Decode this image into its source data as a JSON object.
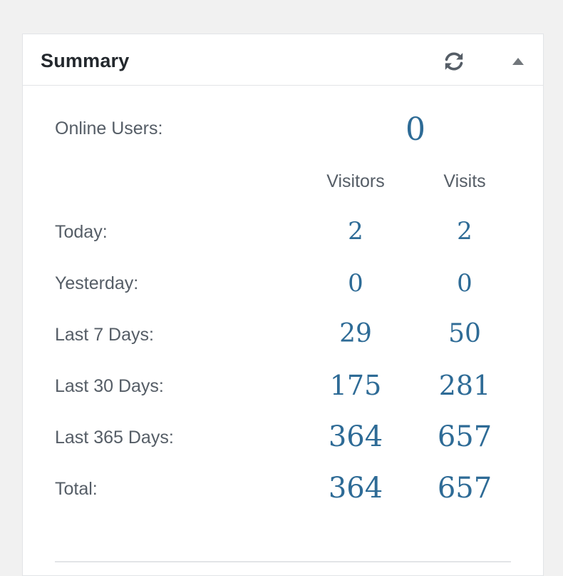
{
  "widget": {
    "title": "Summary",
    "refresh_icon": "refresh-icon",
    "toggle_icon": "triangle-up-icon"
  },
  "online": {
    "label": "Online Users:",
    "value": "0"
  },
  "columns": {
    "visitors": "Visitors",
    "visits": "Visits"
  },
  "rows": [
    {
      "label": "Today:",
      "visitors": "2",
      "visits": "2"
    },
    {
      "label": "Yesterday:",
      "visitors": "0",
      "visits": "0"
    },
    {
      "label": "Last 7 Days:",
      "visitors": "29",
      "visits": "50"
    },
    {
      "label": "Last 30 Days:",
      "visitors": "175",
      "visits": "281"
    },
    {
      "label": "Last 365 Days:",
      "visitors": "364",
      "visits": "657"
    },
    {
      "label": "Total:",
      "visitors": "364",
      "visits": "657"
    }
  ],
  "colors": {
    "accent": "#2e6b96",
    "label": "#555d66",
    "title": "#23282d"
  }
}
